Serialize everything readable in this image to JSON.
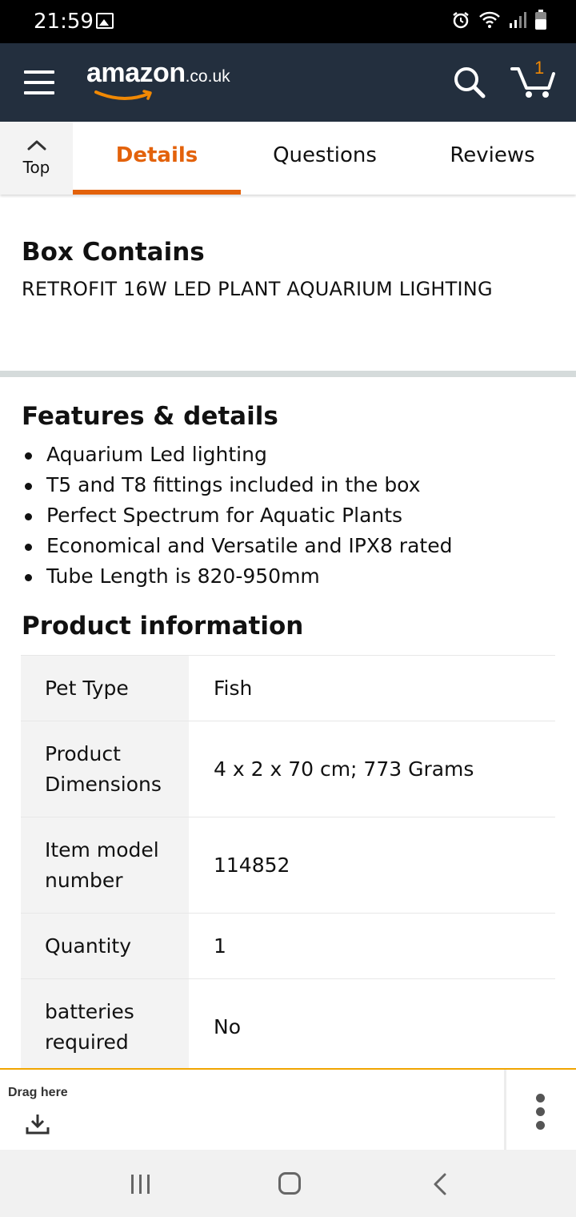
{
  "status_bar": {
    "time": "21:59",
    "icons": [
      "image-icon",
      "alarm-icon",
      "wifi-icon",
      "signal-icon",
      "battery-icon"
    ]
  },
  "header": {
    "logo_main": "amazon",
    "logo_suffix": ".co.uk",
    "cart_count": "1",
    "brand_colors": {
      "header_bg": "#232f3e",
      "accent": "#f08804"
    }
  },
  "tabs": {
    "top_label": "Top",
    "items": [
      {
        "label": "Details",
        "active": true
      },
      {
        "label": "Questions",
        "active": false
      },
      {
        "label": "Reviews",
        "active": false
      }
    ],
    "active_color": "#e3620b"
  },
  "box_contains": {
    "title": "Box Contains",
    "text": "RETROFIT 16W LED PLANT AQUARIUM LIGHTING"
  },
  "features": {
    "title": "Features & details",
    "items": [
      "Aquarium Led lighting",
      "T5 and T8 fittings included in the box",
      "Perfect Spectrum for Aquatic Plants",
      "Economical and Versatile and IPX8 rated",
      "Tube Length is 820-950mm"
    ]
  },
  "product_info": {
    "title": "Product information",
    "rows": [
      {
        "key": "Pet Type",
        "value": "Fish"
      },
      {
        "key": "Product Dimensions",
        "value": "4 x 2 x 70 cm; 773 Grams"
      },
      {
        "key": "Item model number",
        "value": "114852"
      },
      {
        "key": "Quantity",
        "value": "1"
      },
      {
        "key": "batteries required",
        "value": "No"
      }
    ]
  },
  "drag_bar": {
    "label": "Drag here"
  }
}
